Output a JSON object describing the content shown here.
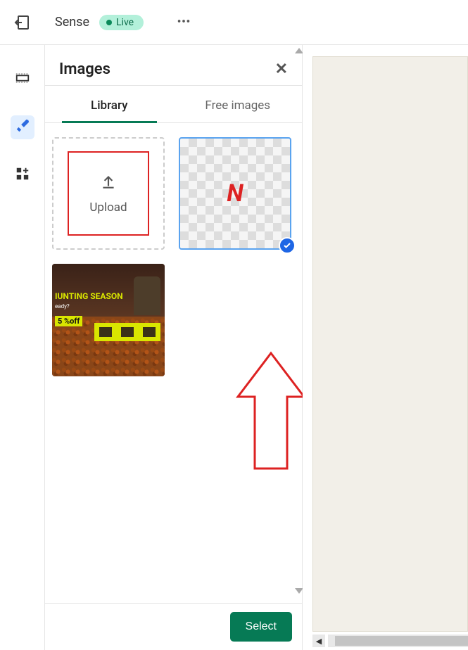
{
  "header": {
    "title": "Sense",
    "live_label": "Live"
  },
  "panel": {
    "title": "Images",
    "tabs": {
      "library": "Library",
      "free": "Free images",
      "active": "library"
    },
    "upload_label": "Upload",
    "select_button": "Select",
    "selected_image_letter": "N",
    "hunting_card": {
      "headline": "IUNTING SEASON",
      "sub": "eady?",
      "off": "5 %off"
    }
  },
  "sidebar": {
    "items": [
      "layers",
      "design",
      "widgets"
    ],
    "active_index": 1
  }
}
